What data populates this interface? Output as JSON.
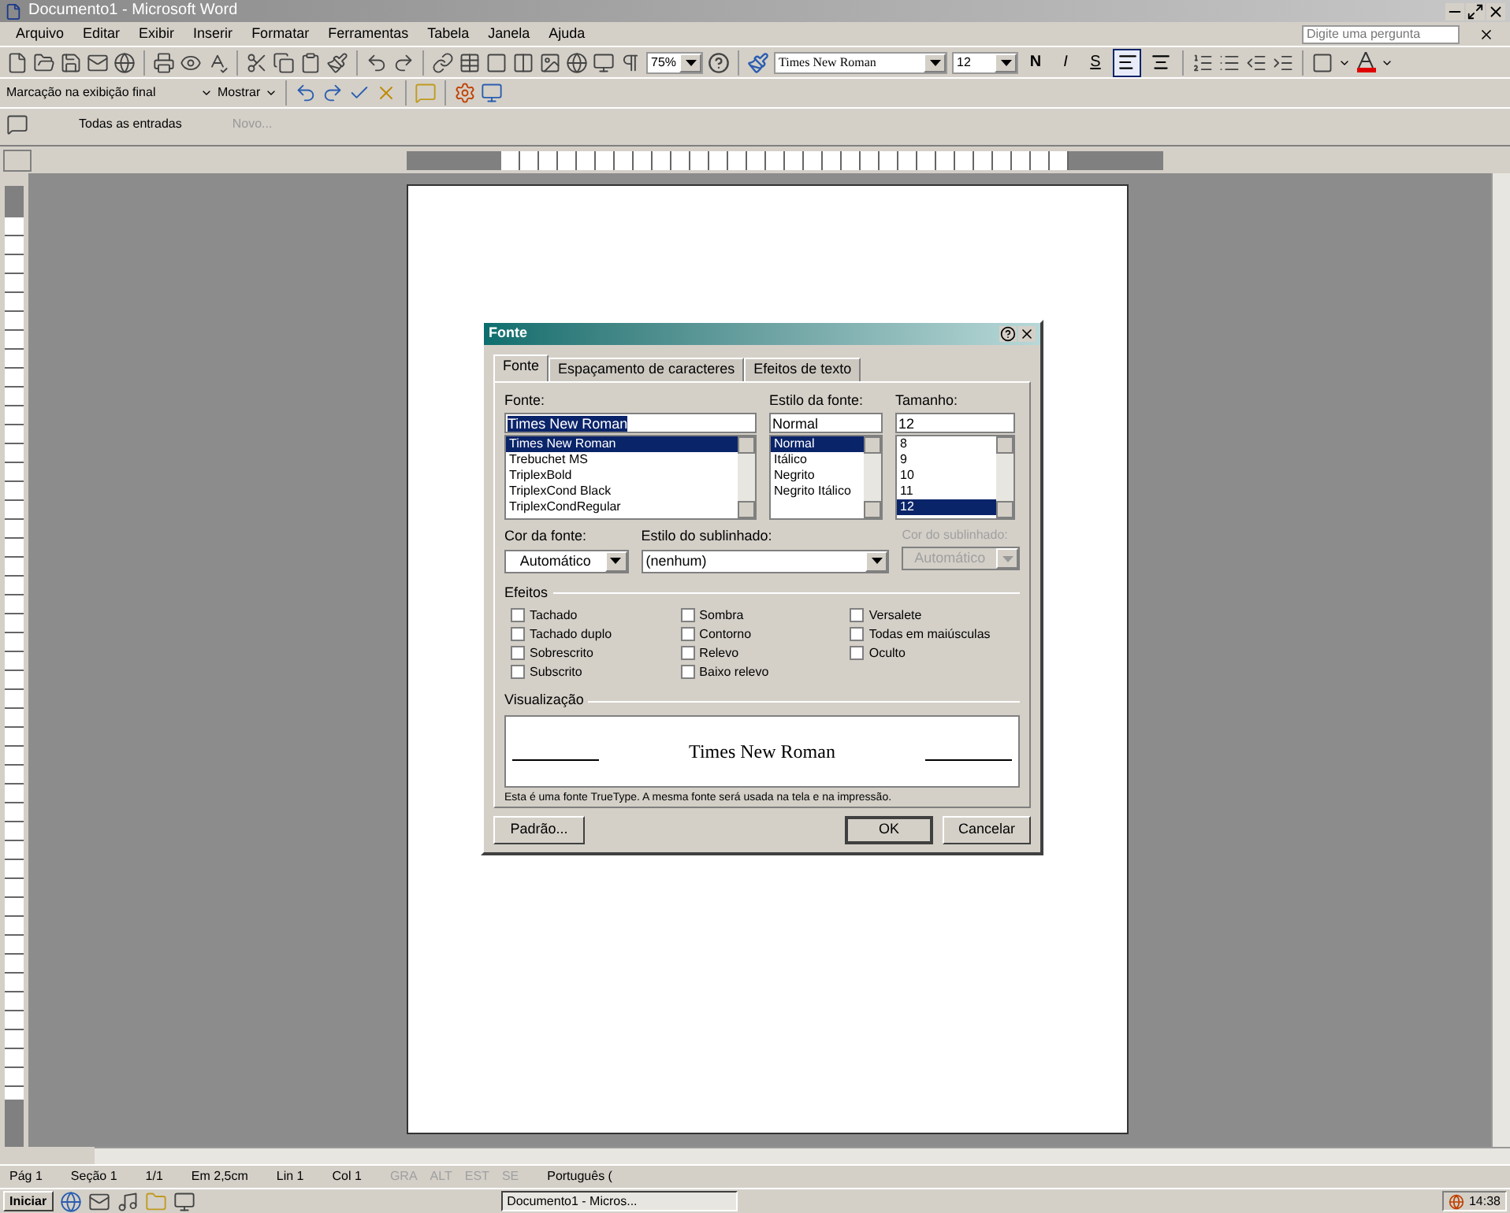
{
  "window": {
    "title": "Documento1 - Microsoft Word"
  },
  "menu": [
    "Arquivo",
    "Editar",
    "Exibir",
    "Inserir",
    "Formatar",
    "Ferramentas",
    "Tabela",
    "Janela",
    "Ajuda"
  ],
  "help_box": {
    "placeholder": "Digite uma pergunta"
  },
  "standard_toolbar": {
    "zoom": "75%"
  },
  "format_toolbar": {
    "font": "Times New Roman",
    "size": "12",
    "style_buttons": [
      "N",
      "I",
      "S"
    ],
    "align_buttons": [
      {
        "selected": true
      },
      {
        "selected": false
      }
    ]
  },
  "review_toolbar": {
    "display": "Marcação na exibição final",
    "show": "Mostrar"
  },
  "review_toolbar_2": {
    "entries": "Todas as entradas",
    "new": "Novo..."
  },
  "dialog": {
    "title": "Fonte",
    "tabs": [
      {
        "label": "Fonte",
        "selected": true
      },
      {
        "label": "Espaçamento de caracteres",
        "selected": false
      },
      {
        "label": "Efeitos de texto",
        "selected": false
      }
    ],
    "font_label": "Fonte:",
    "font_value": "Times New Roman",
    "fonts": [
      {
        "label": "Times New Roman",
        "selected": true
      },
      {
        "label": "Trebuchet MS",
        "selected": false
      },
      {
        "label": "TriplexBold",
        "selected": false
      },
      {
        "label": "TriplexCond Black",
        "selected": false
      },
      {
        "label": "TriplexCondRegular",
        "selected": false
      }
    ],
    "style_label": "Estilo da fonte:",
    "style_value": "Normal",
    "styles": [
      {
        "label": "Normal",
        "selected": true
      },
      {
        "label": "Itálico",
        "selected": false
      },
      {
        "label": "Negrito",
        "selected": false
      },
      {
        "label": "Negrito Itálico",
        "selected": false
      }
    ],
    "size_label": "Tamanho:",
    "size_value": "12",
    "sizes": [
      {
        "label": "8",
        "selected": false
      },
      {
        "label": "9",
        "selected": false
      },
      {
        "label": "10",
        "selected": false
      },
      {
        "label": "11",
        "selected": false
      },
      {
        "label": "12",
        "selected": true
      }
    ],
    "color_label": "Cor da fonte:",
    "color_value": "Automático",
    "underline_label": "Estilo do sublinhado:",
    "underline_value": "(nenhum)",
    "underline_color_label": "Cor do sublinhado:",
    "underline_color_value": "Automático",
    "underline_color_disabled": true,
    "effects_label": "Efeitos",
    "effects": [
      [
        {
          "label": "Tachado",
          "checked": false
        },
        {
          "label": "Tachado duplo",
          "checked": false
        },
        {
          "label": "Sobrescrito",
          "checked": false
        },
        {
          "label": "Subscrito",
          "checked": false
        }
      ],
      [
        {
          "label": "Sombra",
          "checked": false
        },
        {
          "label": "Contorno",
          "checked": false
        },
        {
          "label": "Relevo",
          "checked": false
        },
        {
          "label": "Baixo relevo",
          "checked": false
        }
      ],
      [
        {
          "label": "Versalete",
          "checked": false
        },
        {
          "label": "Todas em maiúsculas",
          "checked": false
        },
        {
          "label": "Oculto",
          "checked": false
        }
      ]
    ],
    "preview_label": "Visualização",
    "preview_text": "Times New Roman",
    "note": "Esta é uma fonte TrueType. A mesma fonte será usada na tela e na impressão.",
    "buttons": {
      "default": "Padrão...",
      "ok": "OK",
      "cancel": "Cancelar"
    }
  },
  "status_bar": [
    "Pág 1",
    "Seção 1",
    "1/1",
    "Em 2,5cm",
    "Lin 1",
    "Col 1"
  ],
  "status_modes": [
    {
      "label": "GRA",
      "on": false
    },
    {
      "label": "ALT",
      "on": false
    },
    {
      "label": "EST",
      "on": false
    },
    {
      "label": "SE",
      "on": false
    }
  ],
  "language": "Português (",
  "taskbar": {
    "start": "Iniciar",
    "task": "Documento1 - Micros...",
    "clock": "14:38"
  }
}
